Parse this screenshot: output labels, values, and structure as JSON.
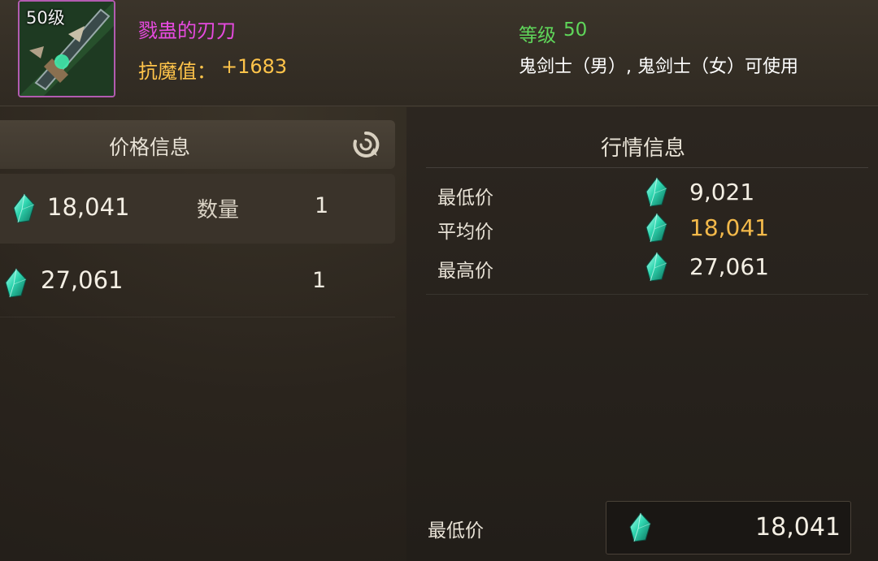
{
  "item": {
    "level_badge": "50级",
    "name": "戮蛊的刃刀",
    "stat_label": "抗魔值：",
    "stat_value": "+1683",
    "level_label": "等级",
    "level_value": "50",
    "usable": "鬼剑士（男）, 鬼剑士（女）可使用"
  },
  "price_panel": {
    "title": "价格信息",
    "refresh_icon": "refresh-icon",
    "qty_label": "数量",
    "rows": [
      {
        "price": "18,041",
        "qty": "1"
      },
      {
        "price": "27,061",
        "qty": "1"
      }
    ]
  },
  "market_panel": {
    "title": "行情信息",
    "rows": [
      {
        "label": "最低价",
        "value": "9,021"
      },
      {
        "label": "平均价",
        "value": "18,041"
      },
      {
        "label": "最高价",
        "value": "27,061"
      }
    ]
  },
  "bottom": {
    "label": "最低价",
    "value": "18,041"
  },
  "colors": {
    "item_name": "#e64adf",
    "stat": "#ffc44a",
    "level": "#5fd65a",
    "avg_price": "#f3b94a"
  }
}
